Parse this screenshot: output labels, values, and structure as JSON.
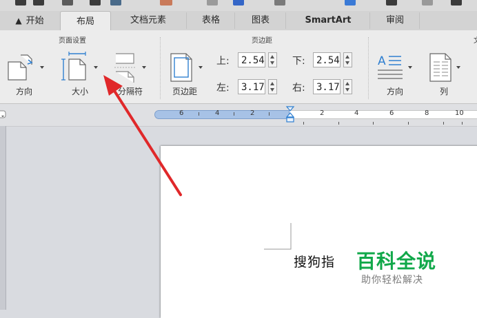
{
  "tabs": [
    {
      "label": "开始",
      "icon": "home-icon"
    },
    {
      "label": "布局",
      "active": true
    },
    {
      "label": "文档元素"
    },
    {
      "label": "表格"
    },
    {
      "label": "图表"
    },
    {
      "label": "SmartArt"
    },
    {
      "label": "审阅"
    }
  ],
  "ribbon": {
    "page_setup": {
      "title": "页面设置",
      "orientation_label": "方向",
      "size_label": "大小",
      "breaks_label": "分隔符"
    },
    "margins": {
      "title": "页边距",
      "margins_label": "页边距",
      "top_label": "上:",
      "top_value": "2.54",
      "bottom_label": "下:",
      "bottom_value": "2.54",
      "left_label": "左:",
      "left_value": "3.17",
      "right_label": "右:",
      "right_value": "3.17"
    },
    "text_layout": {
      "title_fragment": "文",
      "direction_label": "方向",
      "columns_label": "列"
    }
  },
  "ruler": {
    "numbers_left": [
      "6",
      "4",
      "2"
    ],
    "numbers_right": [
      "2",
      "4",
      "6",
      "8",
      "10"
    ]
  },
  "document": {
    "text": "搜狗指"
  },
  "watermark": {
    "main": "百科全说",
    "sub": "助你轻松解决"
  },
  "colors": {
    "annotation_arrow": "#e0282a",
    "watermark_green": "#11a84a",
    "ruler_bar": "#a7c2e6"
  }
}
